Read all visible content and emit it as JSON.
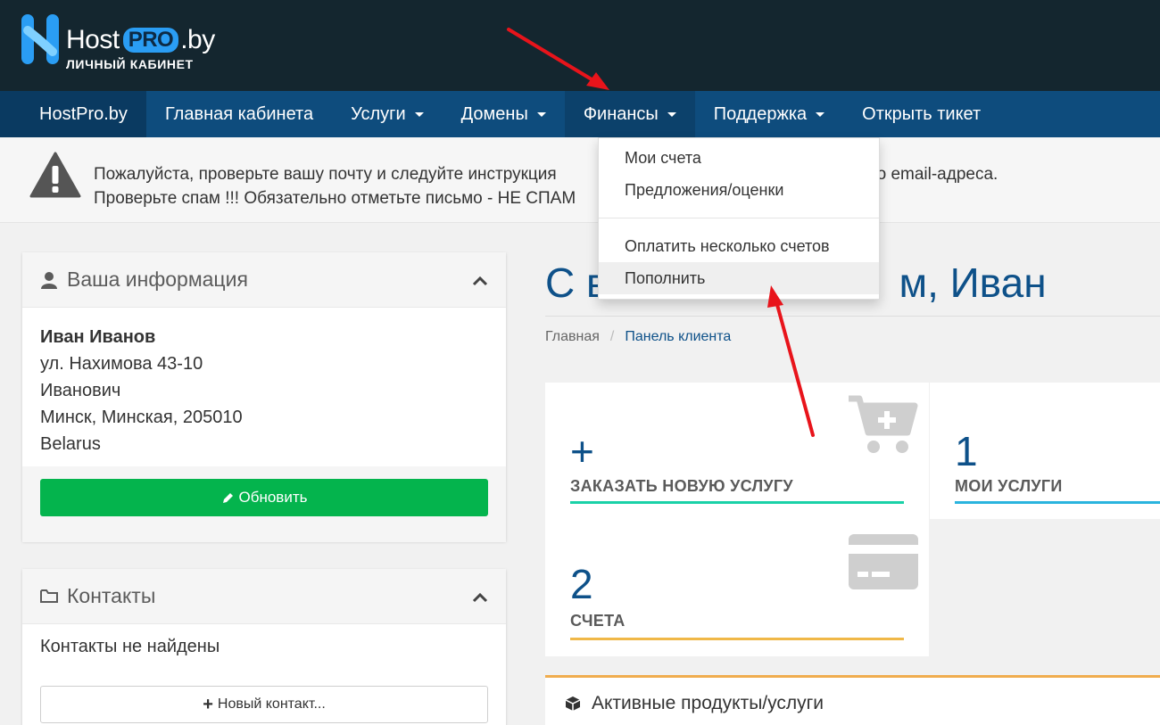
{
  "header": {
    "logo_host": "Host",
    "logo_pro": "PRO",
    "logo_tld": ".by",
    "logo_subtitle": "ЛИЧНЫЙ КАБИНЕТ"
  },
  "nav": {
    "brand": "HostPro.by",
    "items": [
      {
        "label": "Главная кабинета"
      },
      {
        "label": "Услуги"
      },
      {
        "label": "Домены"
      },
      {
        "label": "Финансы"
      },
      {
        "label": "Поддержка"
      },
      {
        "label": "Открыть тикет"
      }
    ]
  },
  "alert": {
    "line1": "Пожалуйста, проверьте вашу почту и следуйте инструкция",
    "line1_end": "ашего email-адреса.",
    "line2": "Проверьте спам !!! Обязательно отметьте письмо - НЕ СПАМ"
  },
  "info_panel": {
    "title": "Ваша информация",
    "name": "Иван Иванов",
    "address": "ул. Нахимова 43-10",
    "patronymic": "Иванович",
    "city": "Минск, Минская, 205010",
    "country": "Belarus",
    "update_label": "Обновить"
  },
  "contacts_panel": {
    "title": "Контакты",
    "empty_text": "Контакты не найдены",
    "new_contact_label": "Новый контакт..."
  },
  "main": {
    "welcome_start": "С в",
    "welcome_end": "м, Иван",
    "breadcrumb_home": "Главная",
    "breadcrumb_sep": "/",
    "breadcrumb_current": "Панель клиента"
  },
  "tiles": {
    "order": {
      "value": "+",
      "label": "ЗАКАЗАТЬ НОВУЮ УСЛУГУ",
      "color": "#1ad1a7"
    },
    "services": {
      "value": "1",
      "label": "МОИ УСЛУГИ",
      "color": "#2ab4de"
    },
    "invoices": {
      "value": "2",
      "label": "СЧЕТА",
      "color": "#f0b848"
    }
  },
  "active_products": {
    "title": "Активные продукты/услуги"
  },
  "dropdown": {
    "items": [
      {
        "label": "Мои счета"
      },
      {
        "label": "Предложения/оценки"
      },
      {
        "label": "Оплатить несколько счетов"
      },
      {
        "label": "Пополнить"
      }
    ]
  },
  "colors": {
    "header_bg": "#14262f",
    "nav_bg": "#0e4c7d",
    "accent_blue": "#0e5189",
    "update_green": "#04b44d",
    "annotation_red": "#e8141b"
  }
}
